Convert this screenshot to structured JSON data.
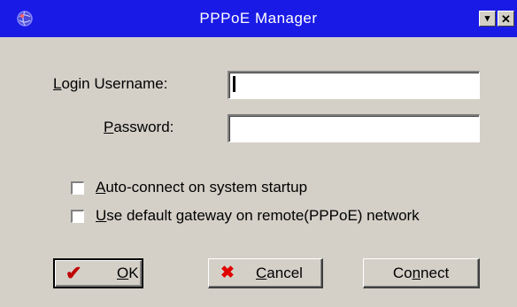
{
  "window": {
    "title": "PPPoE Manager",
    "titlebar_color": "#1a1ae6",
    "icon": "app-globe-icon",
    "menu_button_glyph": "▾",
    "close_button_glyph": "✕"
  },
  "form": {
    "username": {
      "label_prefix": "",
      "label_mnemonic": "L",
      "label_rest": "ogin Username:",
      "value": ""
    },
    "password": {
      "label_prefix": "",
      "label_mnemonic": "P",
      "label_rest": "assword:",
      "value": ""
    },
    "options": [
      {
        "label_mnemonic": "A",
        "label_rest": "uto-connect on system startup",
        "checked": false
      },
      {
        "label_mnemonic": "U",
        "label_rest": "se default gateway on remote(PPPoE) network",
        "checked": false
      }
    ]
  },
  "buttons": {
    "ok": {
      "icon": "checkmark-icon",
      "icon_glyph": "✔",
      "icon_color": "#c00000",
      "label_mnemonic": "O",
      "label_rest": "K"
    },
    "cancel": {
      "icon": "x-mark-icon",
      "icon_glyph": "✖",
      "icon_color": "#e00000",
      "label_mnemonic": "C",
      "label_rest": "ancel"
    },
    "connect": {
      "label_prefix": "Co",
      "label_mnemonic": "n",
      "label_rest": "nect"
    }
  }
}
